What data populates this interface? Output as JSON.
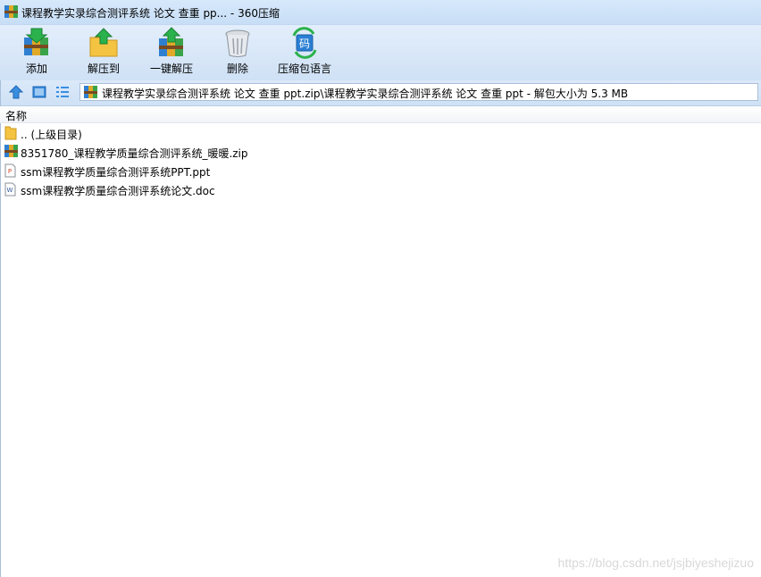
{
  "window": {
    "title": "课程教学实录综合测评系统 论文 查重 pp... - 360压缩"
  },
  "toolbar": {
    "buttons": [
      {
        "label": "添加",
        "icon": "add-archive-icon"
      },
      {
        "label": "解压到",
        "icon": "extract-to-icon"
      },
      {
        "label": "一键解压",
        "icon": "one-click-extract-icon"
      },
      {
        "label": "删除",
        "icon": "trash-icon"
      },
      {
        "label": "压缩包语言",
        "icon": "archive-encoding-icon"
      }
    ]
  },
  "navbar": {
    "address": "课程教学实录综合测评系统 论文 查重 ppt.zip\\课程教学实录综合测评系统 论文 查重 ppt - 解包大小为 5.3 MB"
  },
  "list": {
    "column_name": "名称",
    "items": [
      {
        "name": ".. (上级目录)",
        "icon": "folder-icon"
      },
      {
        "name": "8351780_课程教学质量综合测评系统_暖暖.zip",
        "icon": "zip-archive-icon"
      },
      {
        "name": "ssm课程教学质量综合测评系统PPT.ppt",
        "icon": "ppt-file-icon"
      },
      {
        "name": "ssm课程教学质量综合测评系统论文.doc",
        "icon": "doc-file-icon"
      }
    ]
  },
  "watermark": "https://blog.csdn.net/jsjbiyeshejizuo",
  "colors": {
    "title_bar": "#d7e8fb",
    "toolbar": "#cfe1f5",
    "accent": "#2a7fd4"
  }
}
